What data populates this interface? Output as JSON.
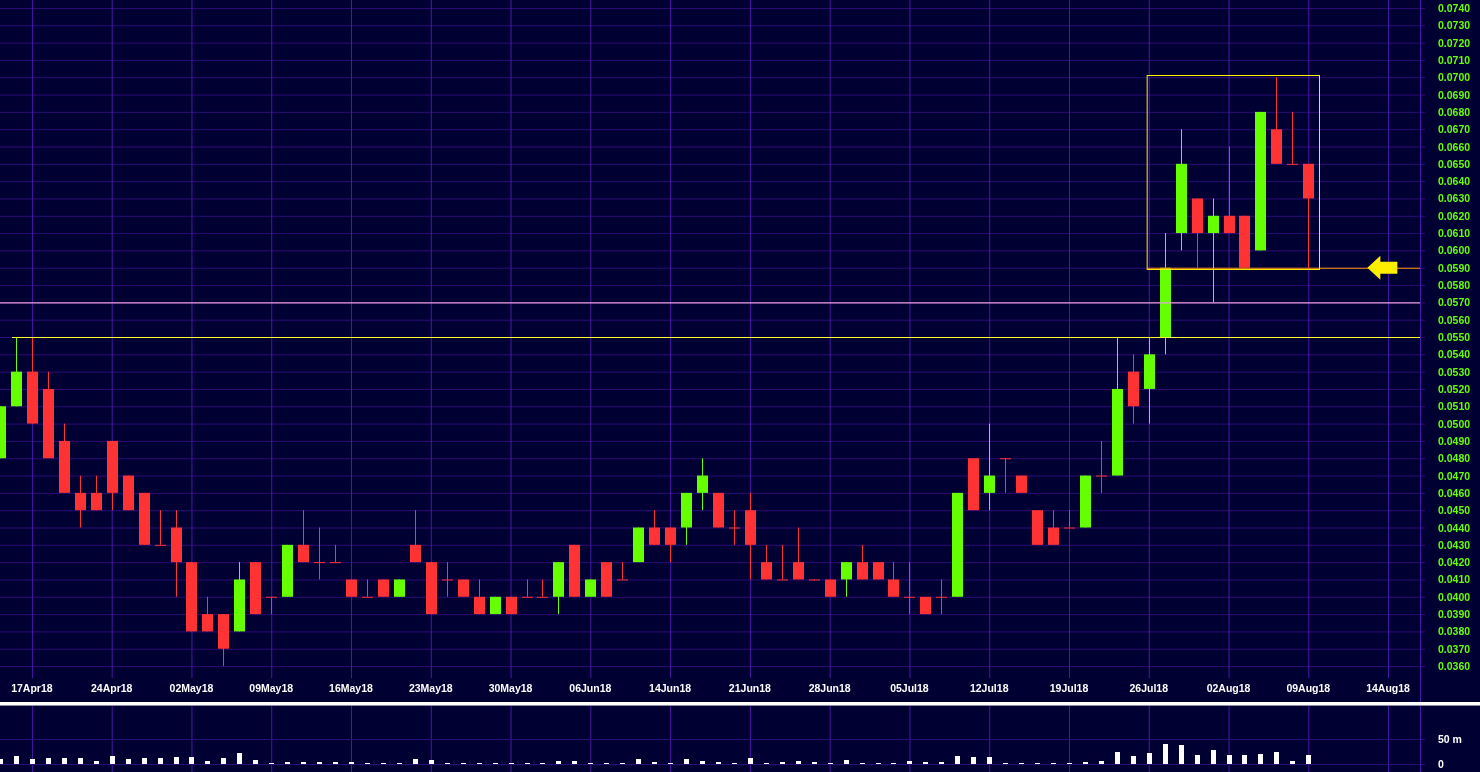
{
  "price_chart": {
    "chart_data": {
      "type": "candlestick",
      "grid": true,
      "categories": [
        null,
        null,
        "17Apr18",
        null,
        null,
        null,
        null,
        "24Apr18",
        null,
        null,
        null,
        null,
        "02May18",
        null,
        null,
        null,
        null,
        "09May18",
        null,
        null,
        null,
        null,
        "16May18",
        null,
        null,
        null,
        null,
        "23May18",
        null,
        null,
        null,
        null,
        "30May18",
        null,
        null,
        null,
        null,
        "06Jun18",
        null,
        null,
        null,
        null,
        "14Jun18",
        null,
        null,
        null,
        null,
        "21Jun18",
        null,
        null,
        null,
        null,
        "28Jun18",
        null,
        null,
        null,
        null,
        "05Jul18",
        null,
        null,
        null,
        null,
        "12Jul18",
        null,
        null,
        null,
        null,
        "19Jul18",
        null,
        null,
        null,
        null,
        "26Jul18",
        null,
        null,
        null,
        null,
        "02Aug18",
        null,
        null,
        null,
        null,
        "09Aug18",
        null,
        null,
        null,
        null,
        "14Aug18",
        null
      ],
      "ylim": [
        0.03531,
        0.07446
      ],
      "yticks": [
        {
          "value": 0.074,
          "label": "0.0740"
        },
        {
          "value": 0.073,
          "label": "0.0730"
        },
        {
          "value": 0.072,
          "label": "0.0720"
        },
        {
          "value": 0.071,
          "label": "0.0710"
        },
        {
          "value": 0.07,
          "label": "0.0700"
        },
        {
          "value": 0.069,
          "label": "0.0690"
        },
        {
          "value": 0.068,
          "label": "0.0680"
        },
        {
          "value": 0.067,
          "label": "0.0670"
        },
        {
          "value": 0.066,
          "label": "0.0660"
        },
        {
          "value": 0.065,
          "label": "0.0650"
        },
        {
          "value": 0.064,
          "label": "0.0640"
        },
        {
          "value": 0.063,
          "label": "0.0630"
        },
        {
          "value": 0.062,
          "label": "0.0620"
        },
        {
          "value": 0.061,
          "label": "0.0610"
        },
        {
          "value": 0.06,
          "label": "0.0600"
        },
        {
          "value": 0.059,
          "label": "0.0590"
        },
        {
          "value": 0.058,
          "label": "0.0580"
        },
        {
          "value": 0.057,
          "label": "0.0570"
        },
        {
          "value": 0.056,
          "label": "0.0560"
        },
        {
          "value": 0.055,
          "label": "0.0550"
        },
        {
          "value": 0.054,
          "label": "0.0540"
        },
        {
          "value": 0.053,
          "label": "0.0530"
        },
        {
          "value": 0.052,
          "label": "0.0520"
        },
        {
          "value": 0.051,
          "label": "0.0510"
        },
        {
          "value": 0.05,
          "label": "0.0500"
        },
        {
          "value": 0.049,
          "label": "0.0490"
        },
        {
          "value": 0.048,
          "label": "0.0480"
        },
        {
          "value": 0.047,
          "label": "0.0470"
        },
        {
          "value": 0.046,
          "label": "0.0460"
        },
        {
          "value": 0.045,
          "label": "0.0450"
        },
        {
          "value": 0.044,
          "label": "0.0440"
        },
        {
          "value": 0.043,
          "label": "0.0430"
        },
        {
          "value": 0.042,
          "label": "0.0420"
        },
        {
          "value": 0.041,
          "label": "0.0410"
        },
        {
          "value": 0.04,
          "label": "0.0400"
        },
        {
          "value": 0.039,
          "label": "0.0390"
        },
        {
          "value": 0.038,
          "label": "0.0380"
        },
        {
          "value": 0.037,
          "label": "0.0370"
        },
        {
          "value": 0.036,
          "label": "0.0360"
        }
      ],
      "ohlc": [
        [
          0.048,
          0.051,
          0.048,
          0.051
        ],
        [
          0.051,
          0.055,
          0.051,
          0.053
        ],
        [
          0.053,
          0.055,
          0.05,
          0.05
        ],
        [
          0.052,
          0.053,
          0.048,
          0.048
        ],
        [
          0.049,
          0.05,
          0.046,
          0.046
        ],
        [
          0.046,
          0.047,
          0.044,
          0.045
        ],
        [
          0.046,
          0.047,
          0.045,
          0.045
        ],
        [
          0.049,
          0.049,
          0.045,
          0.046
        ],
        [
          0.047,
          0.047,
          0.045,
          0.045
        ],
        [
          0.046,
          0.046,
          0.043,
          0.043
        ],
        [
          0.043,
          0.045,
          0.043,
          0.043
        ],
        [
          0.044,
          0.045,
          0.04,
          0.042
        ],
        [
          0.042,
          0.042,
          0.038,
          0.038
        ],
        [
          0.039,
          0.04,
          0.038,
          0.038
        ],
        [
          0.039,
          0.039,
          0.036,
          0.037
        ],
        [
          0.038,
          0.042,
          0.038,
          0.041
        ],
        [
          0.042,
          0.042,
          0.039,
          0.039
        ],
        [
          0.04,
          0.04,
          0.039,
          0.04
        ],
        [
          0.04,
          0.043,
          0.04,
          0.043
        ],
        [
          0.043,
          0.045,
          0.042,
          0.042
        ],
        [
          0.042,
          0.044,
          0.041,
          0.042
        ],
        [
          0.042,
          0.043,
          0.042,
          0.042
        ],
        [
          0.041,
          0.041,
          0.04,
          0.04
        ],
        [
          0.04,
          0.041,
          0.04,
          0.04
        ],
        [
          0.041,
          0.041,
          0.04,
          0.04
        ],
        [
          0.04,
          0.041,
          0.04,
          0.041
        ],
        [
          0.043,
          0.045,
          0.042,
          0.042
        ],
        [
          0.042,
          0.042,
          0.039,
          0.039
        ],
        [
          0.041,
          0.042,
          0.04,
          0.041
        ],
        [
          0.041,
          0.041,
          0.04,
          0.04
        ],
        [
          0.04,
          0.041,
          0.039,
          0.039
        ],
        [
          0.039,
          0.04,
          0.039,
          0.04
        ],
        [
          0.04,
          0.04,
          0.039,
          0.039
        ],
        [
          0.04,
          0.041,
          0.04,
          0.04
        ],
        [
          0.04,
          0.041,
          0.04,
          0.04
        ],
        [
          0.04,
          0.042,
          0.039,
          0.042
        ],
        [
          0.043,
          0.043,
          0.04,
          0.04
        ],
        [
          0.04,
          0.041,
          0.04,
          0.041
        ],
        [
          0.042,
          0.042,
          0.04,
          0.04
        ],
        [
          0.041,
          0.042,
          0.041,
          0.041
        ],
        [
          0.042,
          0.044,
          0.042,
          0.044
        ],
        [
          0.044,
          0.045,
          0.043,
          0.043
        ],
        [
          0.044,
          0.044,
          0.042,
          0.043
        ],
        [
          0.044,
          0.046,
          0.043,
          0.046
        ],
        [
          0.046,
          0.048,
          0.045,
          0.047
        ],
        [
          0.046,
          0.046,
          0.044,
          0.044
        ],
        [
          0.044,
          0.045,
          0.043,
          0.044
        ],
        [
          0.045,
          0.046,
          0.041,
          0.043
        ],
        [
          0.042,
          0.043,
          0.041,
          0.041
        ],
        [
          0.041,
          0.043,
          0.041,
          0.041
        ],
        [
          0.042,
          0.044,
          0.041,
          0.041
        ],
        [
          0.041,
          0.041,
          0.041,
          0.041
        ],
        [
          0.041,
          0.041,
          0.04,
          0.04
        ],
        [
          0.041,
          0.042,
          0.04,
          0.042
        ],
        [
          0.042,
          0.043,
          0.041,
          0.041
        ],
        [
          0.042,
          0.042,
          0.041,
          0.041
        ],
        [
          0.041,
          0.042,
          0.04,
          0.04
        ],
        [
          0.04,
          0.042,
          0.039,
          0.04
        ],
        [
          0.04,
          0.04,
          0.039,
          0.039
        ],
        [
          0.04,
          0.041,
          0.039,
          0.04
        ],
        [
          0.04,
          0.046,
          0.04,
          0.046
        ],
        [
          0.048,
          0.048,
          0.045,
          0.045
        ],
        [
          0.046,
          0.05,
          0.045,
          0.047
        ],
        [
          0.048,
          0.048,
          0.046,
          0.048
        ],
        [
          0.047,
          0.047,
          0.046,
          0.046
        ],
        [
          0.045,
          0.045,
          0.043,
          0.043
        ],
        [
          0.044,
          0.045,
          0.043,
          0.043
        ],
        [
          0.044,
          0.045,
          0.044,
          0.044
        ],
        [
          0.044,
          0.047,
          0.044,
          0.047
        ],
        [
          0.047,
          0.049,
          0.046,
          0.047
        ],
        [
          0.047,
          0.055,
          0.047,
          0.052
        ],
        [
          0.053,
          0.054,
          0.05,
          0.051
        ],
        [
          0.052,
          0.055,
          0.05,
          0.054
        ],
        [
          0.055,
          0.061,
          0.054,
          0.059
        ],
        [
          0.061,
          0.067,
          0.06,
          0.065
        ],
        [
          0.063,
          0.063,
          0.059,
          0.061
        ],
        [
          0.061,
          0.063,
          0.057,
          0.062
        ],
        [
          0.062,
          0.066,
          0.061,
          0.061
        ],
        [
          0.062,
          0.062,
          0.059,
          0.059
        ],
        [
          0.06,
          0.068,
          0.06,
          0.068
        ],
        [
          0.067,
          0.07,
          0.065,
          0.065
        ],
        [
          0.065,
          0.068,
          0.065,
          0.065
        ],
        [
          0.065,
          0.065,
          0.059,
          0.063
        ],
        null,
        null,
        null,
        null,
        null,
        null
      ],
      "ref_lines": [
        {
          "axis": "y",
          "value": 0.055,
          "color": "#ffff33"
        },
        {
          "axis": "y",
          "value": 0.057,
          "color": "#e8a0d8"
        },
        {
          "axis": "y",
          "value": 0.059,
          "color": "#ff9900"
        }
      ]
    }
  },
  "volume_chart": {
    "chart_data": {
      "type": "bar",
      "grid": true,
      "ylim": [
        0,
        50
      ],
      "yticks": [
        {
          "value": 50,
          "label": "50 m"
        },
        {
          "value": 0,
          "label": "0"
        }
      ],
      "values": [
        10,
        16,
        10,
        12,
        12,
        12,
        6,
        16,
        10,
        12,
        12,
        14,
        14,
        6,
        12,
        22,
        8,
        2,
        4,
        4,
        4,
        4,
        4,
        2,
        2,
        2,
        10,
        8,
        2,
        2,
        2,
        2,
        2,
        2,
        2,
        6,
        6,
        2,
        2,
        2,
        10,
        4,
        2,
        10,
        6,
        4,
        2,
        12,
        2,
        4,
        6,
        4,
        2,
        8,
        2,
        2,
        2,
        6,
        4,
        4,
        16,
        14,
        14,
        2,
        2,
        2,
        2,
        2,
        4,
        6,
        24,
        16,
        22,
        40,
        38,
        18,
        28,
        18,
        18,
        20,
        24,
        6,
        18,
        null,
        null,
        null,
        null,
        null,
        null
      ]
    }
  }
}
